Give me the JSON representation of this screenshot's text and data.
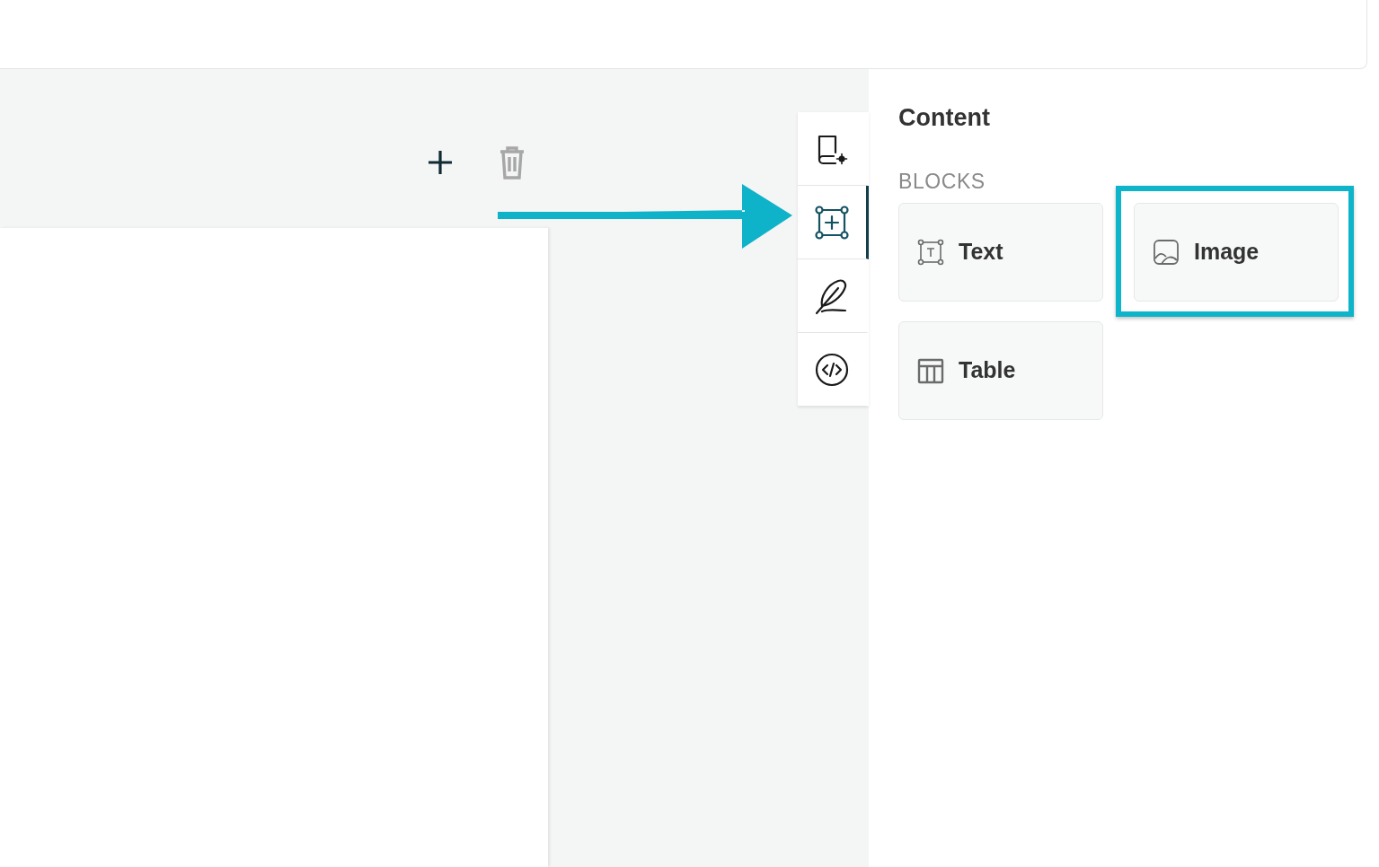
{
  "toolbar": {
    "buttons": [
      {
        "kind": "add",
        "disabled": false
      },
      {
        "kind": "delete",
        "disabled": true
      }
    ]
  },
  "side_tabs": [
    {
      "kind": "settings",
      "selected": false
    },
    {
      "kind": "content",
      "selected": true
    },
    {
      "kind": "design",
      "selected": false
    },
    {
      "kind": "code",
      "selected": false
    }
  ],
  "panel": {
    "title": "Content",
    "section": "BLOCKS",
    "blocks": [
      {
        "kind": "text",
        "label": "Text",
        "highlighted": false
      },
      {
        "kind": "image",
        "label": "Image",
        "highlighted": true
      },
      {
        "kind": "table",
        "label": "Table",
        "highlighted": false
      }
    ]
  }
}
